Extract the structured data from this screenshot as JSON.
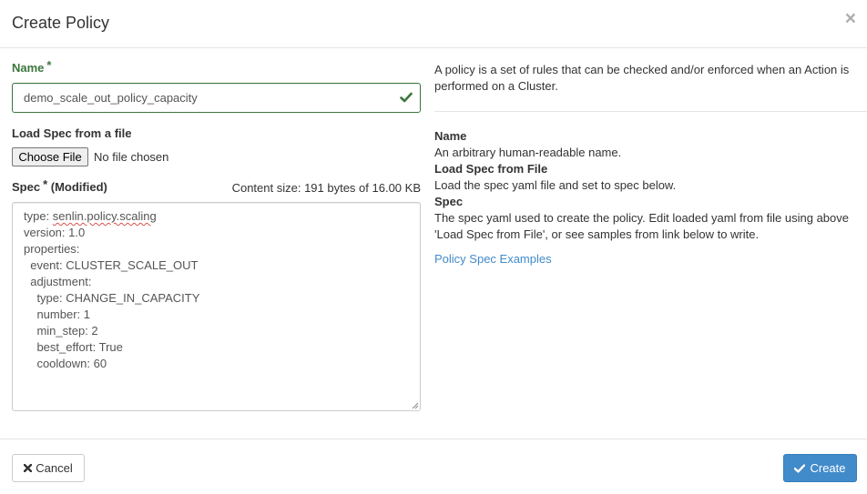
{
  "modal": {
    "title": "Create Policy",
    "close_symbol": "×"
  },
  "form": {
    "name_label": "Name",
    "required_star": "*",
    "name_value": "demo_scale_out_policy_capacity",
    "load_spec_label": "Load Spec from a file",
    "choose_file_label": "Choose File",
    "no_file_text": "No file chosen",
    "spec_label": "Spec",
    "spec_modified": "(Modified)",
    "content_size": "Content size: 191 bytes of 16.00 KB",
    "spec_lines": [
      "type: ",
      "version: 1.0",
      "properties:",
      "  event: CLUSTER_SCALE_OUT",
      "  adjustment:",
      "    type: CHANGE_IN_CAPACITY",
      "    number: 1",
      "    min_step: 2",
      "    best_effort: True",
      "    cooldown: 60"
    ],
    "spec_type_value": "senlin.policy.scaling"
  },
  "help": {
    "intro": "A policy is a set of rules that can be checked and/or enforced when an Action is performed on a Cluster.",
    "name_title": "Name",
    "name_desc": "An arbitrary human-readable name.",
    "load_title": "Load Spec from File",
    "load_desc": "Load the spec yaml file and set to spec below.",
    "spec_title": "Spec",
    "spec_desc": "The spec yaml used to create the policy. Edit loaded yaml from file using above 'Load Spec from File', or see samples from link below to write.",
    "examples_link": "Policy Spec Examples"
  },
  "footer": {
    "cancel_label": "Cancel",
    "create_label": "Create"
  },
  "colors": {
    "success": "#3c763d",
    "primary": "#428bca",
    "link": "#428bca"
  },
  "icons": {
    "close": "close-icon",
    "valid": "check-icon",
    "cancel": "times-icon",
    "create": "check-icon"
  }
}
